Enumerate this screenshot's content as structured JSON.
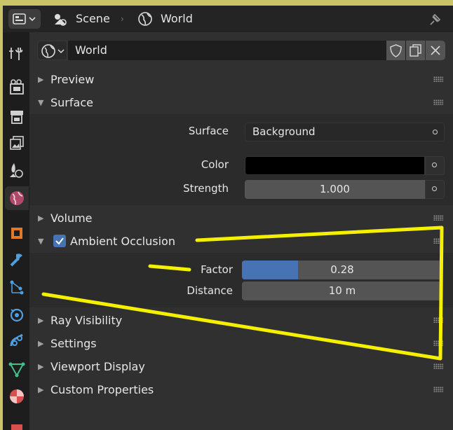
{
  "header": {
    "breadcrumb": [
      "Scene",
      "World"
    ]
  },
  "world_selector": {
    "name": "World"
  },
  "panels": {
    "preview": "Preview",
    "surface": "Surface",
    "volume": "Volume",
    "ambient_occlusion": "Ambient Occlusion",
    "ray_visibility": "Ray Visibility",
    "settings": "Settings",
    "viewport_display": "Viewport Display",
    "custom_properties": "Custom Properties"
  },
  "surface": {
    "surface_label": "Surface",
    "surface_value": "Background",
    "color_label": "Color",
    "color_value": "#000000",
    "strength_label": "Strength",
    "strength_value": "1.000"
  },
  "ambient_occlusion": {
    "enabled": true,
    "factor_label": "Factor",
    "factor_value": "0.28",
    "factor_fraction": 0.28,
    "distance_label": "Distance",
    "distance_value": "10 m"
  },
  "colors": {
    "accent": "#4772b3",
    "annotation": "#f5f000",
    "sidebar_tab_active": "#303030"
  },
  "icons": {
    "editor_type": "properties-editor-icon",
    "scene": "scene-icon",
    "world": "world-icon",
    "pin": "pin-icon",
    "tabs": [
      "tool-icon",
      "render-icon",
      "output-icon",
      "view-layer-icon",
      "scene-icon",
      "world-icon",
      "object-icon",
      "modifier-icon",
      "particles-icon",
      "physics-icon",
      "constraints-icon",
      "data-icon",
      "material-icon"
    ]
  }
}
